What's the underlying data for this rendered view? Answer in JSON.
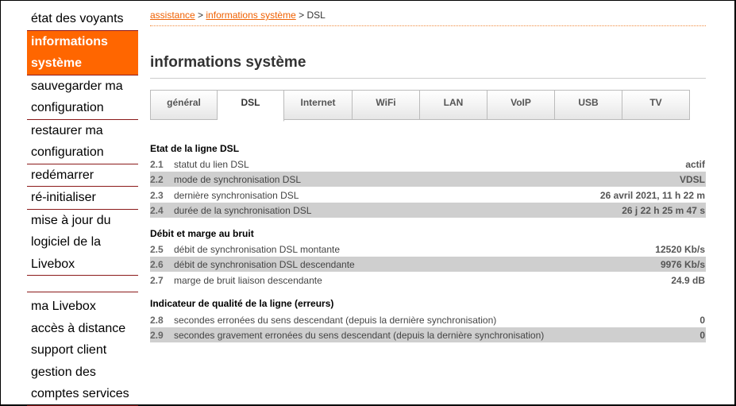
{
  "sidebar": {
    "items": [
      {
        "label": "état des voyants"
      },
      {
        "label": "informations système"
      },
      {
        "label": "sauvegarder ma configuration"
      },
      {
        "label": "restaurer ma configuration"
      },
      {
        "label": "redémarrer"
      },
      {
        "label": "ré-initialiser"
      },
      {
        "label": "mise à jour du logiciel de la Livebox"
      }
    ],
    "links": [
      {
        "label": "ma Livebox"
      },
      {
        "label": "accès à distance"
      },
      {
        "label": "support client"
      },
      {
        "label": "gestion des comptes services"
      }
    ]
  },
  "breadcrumb": {
    "link1": "assistance",
    "sep1": " > ",
    "link2": "informations système",
    "sep2": " > ",
    "current": "DSL"
  },
  "page": {
    "title": "informations système"
  },
  "tabs": [
    {
      "label": "général"
    },
    {
      "label": "DSL"
    },
    {
      "label": "Internet"
    },
    {
      "label": "WiFi"
    },
    {
      "label": "LAN"
    },
    {
      "label": "VoIP"
    },
    {
      "label": "USB"
    },
    {
      "label": "TV"
    }
  ],
  "sections": [
    {
      "title": "Etat de la ligne DSL",
      "rows": [
        {
          "num": "2.1",
          "label": "statut du lien DSL",
          "value": "actif"
        },
        {
          "num": "2.2",
          "label": "mode de synchronisation DSL",
          "value": "VDSL"
        },
        {
          "num": "2.3",
          "label": "dernière synchronisation DSL",
          "value": "26 avril 2021, 11 h 22 m"
        },
        {
          "num": "2.4",
          "label": "durée de la synchronisation DSL",
          "value": "26 j 22 h 25 m 47 s"
        }
      ]
    },
    {
      "title": "Débit et marge au bruit",
      "rows": [
        {
          "num": "2.5",
          "label": "débit de synchronisation DSL montante",
          "value": "12520 Kb/s"
        },
        {
          "num": "2.6",
          "label": "débit de synchronisation DSL descendante",
          "value": "9976 Kb/s"
        },
        {
          "num": "2.7",
          "label": "marge de bruit liaison descendante",
          "value": "24.9 dB"
        }
      ]
    },
    {
      "title": "Indicateur de qualité de la ligne (erreurs)",
      "rows": [
        {
          "num": "2.8",
          "label": "secondes erronées du sens descendant (depuis la dernière synchronisation)",
          "value": "0"
        },
        {
          "num": "2.9",
          "label": "secondes gravement erronées du sens descendant (depuis la dernière synchronisation)",
          "value": "0"
        }
      ]
    }
  ]
}
